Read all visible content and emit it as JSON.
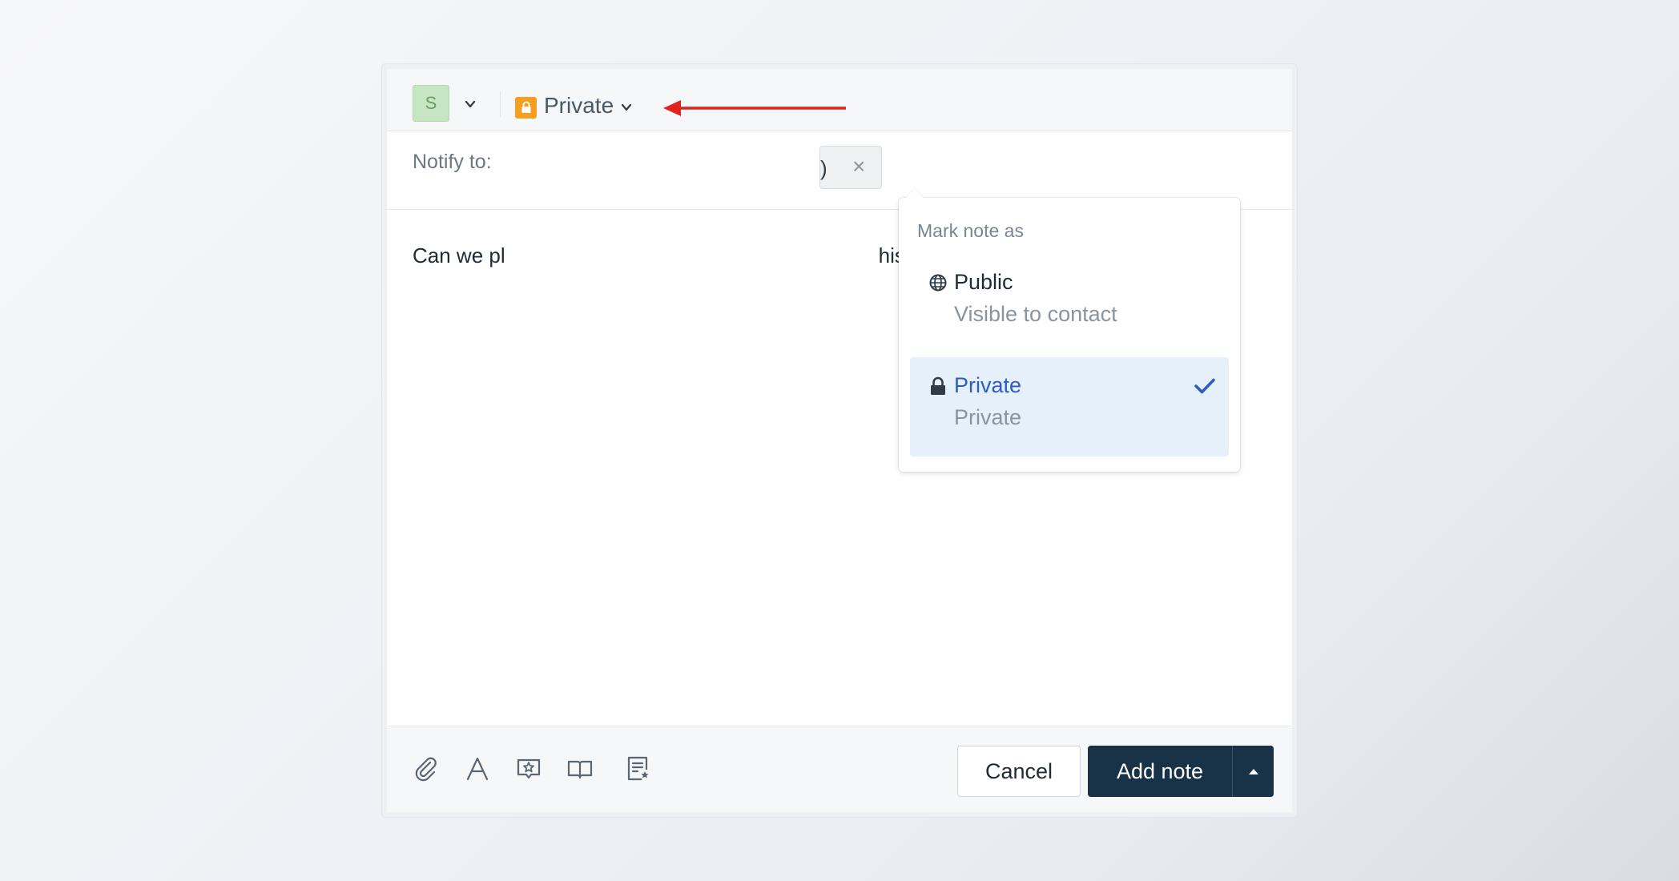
{
  "header": {
    "avatar_initial": "S",
    "visibility_label": "Private"
  },
  "notify": {
    "label": "Notify to:",
    "chip_text_visible": ")",
    "chip_close": "×"
  },
  "note_body": {
    "text_left": "Can we pl",
    "text_right": "his?"
  },
  "dropdown": {
    "header": "Mark note as",
    "options": [
      {
        "title": "Public",
        "subtitle": "Visible to contact",
        "icon": "globe-icon",
        "selected": false
      },
      {
        "title": "Private",
        "subtitle": "Private",
        "icon": "lock-icon",
        "selected": true
      }
    ]
  },
  "toolbar": {
    "tools": [
      "paperclip-icon",
      "text-format-icon",
      "canned-response-icon",
      "knowledge-base-icon",
      "template-icon"
    ],
    "cancel_label": "Cancel",
    "add_note_label": "Add note"
  },
  "colors": {
    "private_badge": "#f59e1f",
    "primary_button": "#183247",
    "selected_option_bg": "#e6f0fa",
    "selected_text": "#2c5cc5",
    "annotation_arrow": "#e0241c"
  }
}
